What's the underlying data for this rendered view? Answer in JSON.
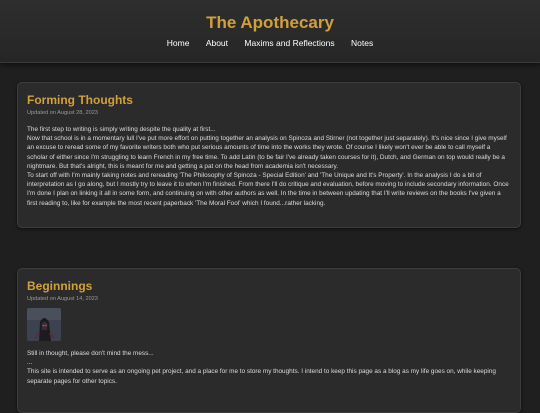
{
  "site": {
    "title": "The Apothecary"
  },
  "nav": [
    "Home",
    "About",
    "Maxims and Reflections",
    "Notes"
  ],
  "posts": [
    {
      "title": "Forming Thoughts",
      "date": "Updated on August 28, 2023",
      "lines": [
        "The first step to writing is simply writing despite the quality at first...",
        "Now that school is in a momentary lull I've put more effort on putting together an analysis on Spinoza and Stirner (not together just separately). It's nice since I give myself an excuse to reread some of my favorite writers both who put serious amounts of time into the works they wrote. Of course I likely won't ever be able to call myself a scholar of either since I'm struggling to learn French in my free time. To add Latin (to be fair I've already taken courses for it), Dutch, and German on top would really be a nightmare. But that's alright, this is meant for me and getting a pat on the head from academia isn't necessary.",
        "To start off with I'm mainly taking notes and rereading 'The Philosophy of Spinoza - Special Edition' and 'The Unique and It's Property'. In the analysis I do a bit of interpretation as I go along, but I mostly try to leave it to when I'm finished. From there I'll do critique and evaluation, before moving to include secondary information. Once I'm done I plan on linking it all in some form, and continuing on with other authors as well. In the time in between updating that I'll write reviews on the books I've given a first reading to, like for example the most recent paperback 'The Moral Fool' which I found...rather lacking."
      ]
    },
    {
      "title": "Beginnings",
      "date": "Updated on August 14, 2023",
      "lines": [
        "Still in thought, please don't mind the mess...",
        "...",
        "This site is intended to serve as an ongoing pet project, and a place for me to store my thoughts. I intend to keep this page as a blog as my life goes on, while keeping separate pages for other topics."
      ]
    }
  ]
}
